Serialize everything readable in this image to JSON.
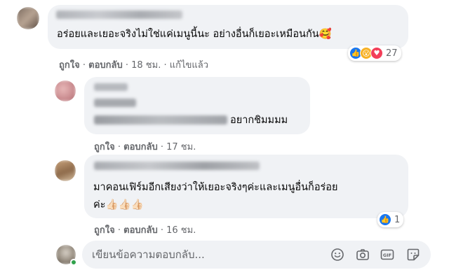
{
  "comments": [
    {
      "text": "อร่อยและเยอะจริงไม่ใช่แค่เมนูนี้นะ อย่างอื่นก็เยอะเหมือนกัน🥰",
      "actions": {
        "like": "ถูกใจ",
        "reply": "ตอบกลับ",
        "time": "18 ชม.",
        "edited": "แก้ไขแล้ว"
      },
      "reactions": {
        "icons": [
          "like-reaction",
          "wow-reaction",
          "love-reaction"
        ],
        "count": "27"
      }
    },
    {
      "text": "อยากชิมมมม",
      "actions": {
        "like": "ถูกใจ",
        "reply": "ตอบกลับ",
        "time": "17 ชม."
      }
    },
    {
      "text_line1": "มาคอนเฟิร์มอีกเสียงว่าให้เยอะจริงๆค่ะและเมนูอื่นก็อร่อย",
      "text_line2": "ค่ะ👍🏻👍🏻👍🏻",
      "actions": {
        "like": "ถูกใจ",
        "reply": "ตอบกลับ",
        "time": "16 ชม."
      },
      "reactions": {
        "icons": [
          "like-reaction"
        ],
        "count": "1"
      }
    }
  ],
  "separator": "·",
  "composer": {
    "placeholder": "เขียนข้อความตอบกลับ..."
  },
  "colors": {
    "like_blue": "#1877f2",
    "wow_yellow": "#f7b125",
    "love_red": "#f33e58",
    "bubble": "#f0f2f5",
    "muted": "#65676b"
  }
}
